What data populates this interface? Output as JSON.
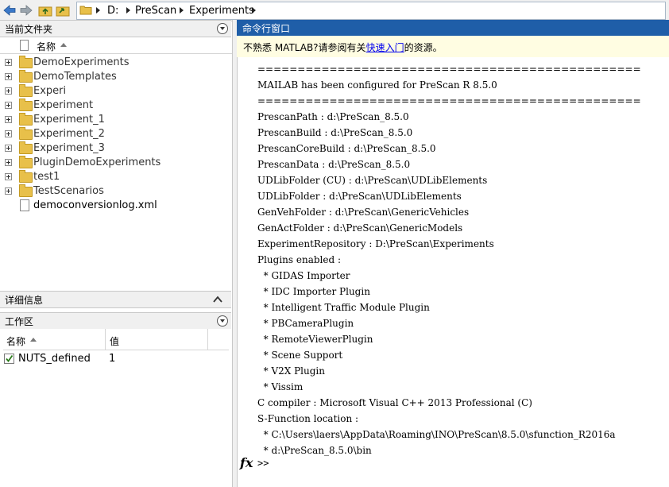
{
  "toolbar": {
    "back_icon": "back-arrow-icon",
    "forward_icon": "forward-arrow-icon",
    "up_icon": "folder-up-icon",
    "browse_icon": "browse-folder-icon"
  },
  "breadcrumb": {
    "icon": "folder-icon",
    "items": [
      "D:",
      "PreScan",
      "Experiments"
    ]
  },
  "file_panel": {
    "title": "当前文件夹",
    "column_name": "名称",
    "items": [
      {
        "name": "DemoExperiments",
        "type": "folder"
      },
      {
        "name": "DemoTemplates",
        "type": "folder"
      },
      {
        "name": "Experi",
        "type": "folder"
      },
      {
        "name": "Experiment",
        "type": "folder"
      },
      {
        "name": "Experiment_1",
        "type": "folder"
      },
      {
        "name": "Experiment_2",
        "type": "folder"
      },
      {
        "name": "Experiment_3",
        "type": "folder"
      },
      {
        "name": "PluginDemoExperiments",
        "type": "folder"
      },
      {
        "name": "test1",
        "type": "folder"
      },
      {
        "name": "TestScenarios",
        "type": "folder"
      },
      {
        "name": "democonversionlog.xml",
        "type": "file"
      }
    ]
  },
  "details_panel": {
    "title": "详细信息"
  },
  "workspace_panel": {
    "title": "工作区",
    "col_name": "名称",
    "col_value": "值",
    "rows": [
      {
        "name": "NUTS_defined",
        "value": "1"
      }
    ]
  },
  "command_window": {
    "title": "命令行窗口",
    "notice_prefix": "不熟悉 MATLAB?请参阅有关",
    "notice_link": "快速入门",
    "notice_suffix": "的资源。",
    "lines": [
      "================================================",
      "MAILAB has been configured for PreScan R 8.5.0",
      "================================================",
      "PrescanPath : d:\\PreScan_8.5.0",
      "PrescanBuild : d:\\PreScan_8.5.0",
      "PrescanCoreBuild : d:\\PreScan_8.5.0",
      "PrescanData : d:\\PreScan_8.5.0",
      "UDLibFolder (CU) : d:\\PreScan\\UDLibElements",
      "UDLibFolder : d:\\PreScan\\UDLibElements",
      "GenVehFolder : d:\\PreScan\\GenericVehicles",
      "GenActFolder : d:\\PreScan\\GenericModels",
      "ExperimentRepository : D:\\PreScan\\Experiments",
      "Plugins enabled :",
      "  * GIDAS Importer",
      "  * IDC Importer Plugin",
      "  * Intelligent Traffic Module Plugin",
      "  * PBCameraPlugin",
      "  * RemoteViewerPlugin",
      "  * Scene Support",
      "  * V2X Plugin",
      "  * Vissim",
      "C compiler : Microsoft Visual C++ 2013 Professional (C)",
      "S-Function location :",
      "  * C:\\Users\\laers\\AppData\\Roaming\\INO\\PreScan\\8.5.0\\sfunction_R2016a",
      "  * d:\\PreScan_8.5.0\\bin"
    ],
    "fx_label": "fx",
    "prompt": ">>"
  }
}
